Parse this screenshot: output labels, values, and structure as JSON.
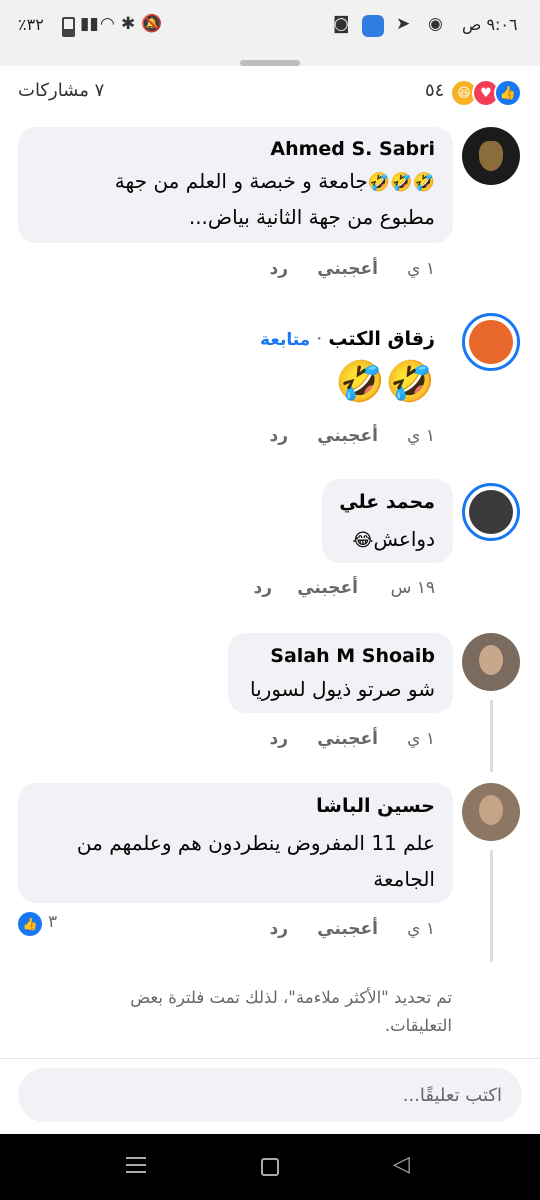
{
  "status_bar": {
    "time": "٩:٠٦ ص",
    "battery": "٪٣٢"
  },
  "header": {
    "shares": "٧ مشاركات",
    "reactions_count": "٥٤"
  },
  "comments": [
    {
      "author": "Ahmed S. Sabri",
      "line1": "جامعة و خبصة و العلم  من جهة",
      "line2": "مطبوع من جهة الثانية  بياض...",
      "time": "١ ي",
      "like": "أعجبني",
      "reply": "رد"
    },
    {
      "author": "زقاق الكتب",
      "follow": "متابعة",
      "time": "١ ي",
      "like": "أعجبني",
      "reply": "رد"
    },
    {
      "author": "محمد علي",
      "text": "دواعش",
      "time": "١٩ س",
      "like": "أعجبني",
      "reply": "رد"
    },
    {
      "author": "Salah M Shoaib",
      "text": "شو صرتو ذيول لسوريا",
      "time": "١ ي",
      "like": "أعجبني",
      "reply": "رد"
    },
    {
      "author": "حسين الباشا",
      "line1": "علم 11 المفروض ينطردون هم وعلمهم من",
      "line2": "الجامعة",
      "time": "١ ي",
      "like": "أعجبني",
      "reply": "رد",
      "reaction_count": "٣"
    }
  ],
  "filter_note": "تم تحديد \"الأكثر ملاءمة\"، لذلك تمت فلترة بعض التعليقات.",
  "composer": {
    "placeholder": "اكتب تعليقًا..."
  },
  "colors": {
    "accent": "#1877f2",
    "bubble": "#f0f2f5",
    "secondary_text": "#65676b",
    "love": "#f33e58",
    "haha": "#f7b125"
  }
}
